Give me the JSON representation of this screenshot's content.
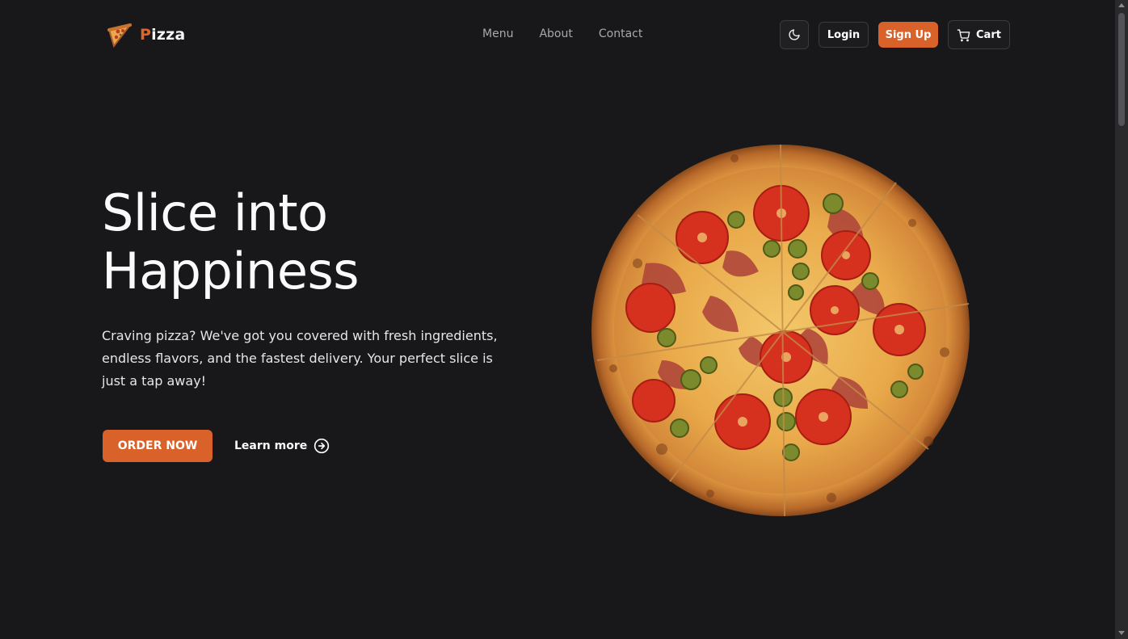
{
  "brand": {
    "logo_icon": "pizza-slice-icon",
    "name_first": "P",
    "name_rest": "izza",
    "accent": "#d9622b"
  },
  "nav": {
    "items": [
      {
        "label": "Menu"
      },
      {
        "label": "About"
      },
      {
        "label": "Contact"
      }
    ]
  },
  "header_actions": {
    "theme_icon": "moon-icon",
    "login_label": "Login",
    "signup_label": "Sign Up",
    "cart_icon": "cart-icon",
    "cart_label": "Cart"
  },
  "hero": {
    "title_line1": "Slice into",
    "title_line2": "Happiness",
    "description": "Craving pizza? We've got you covered with fresh ingredients, endless flavors, and the fastest delivery. Your perfect slice is just a tap away!",
    "order_label": "ORDER NOW",
    "learn_more_label": "Learn more",
    "learn_more_icon": "arrow-right-circle-icon",
    "image": "pizza-image"
  },
  "colors": {
    "background": "#18181a",
    "button_orange": "#d9622b"
  }
}
